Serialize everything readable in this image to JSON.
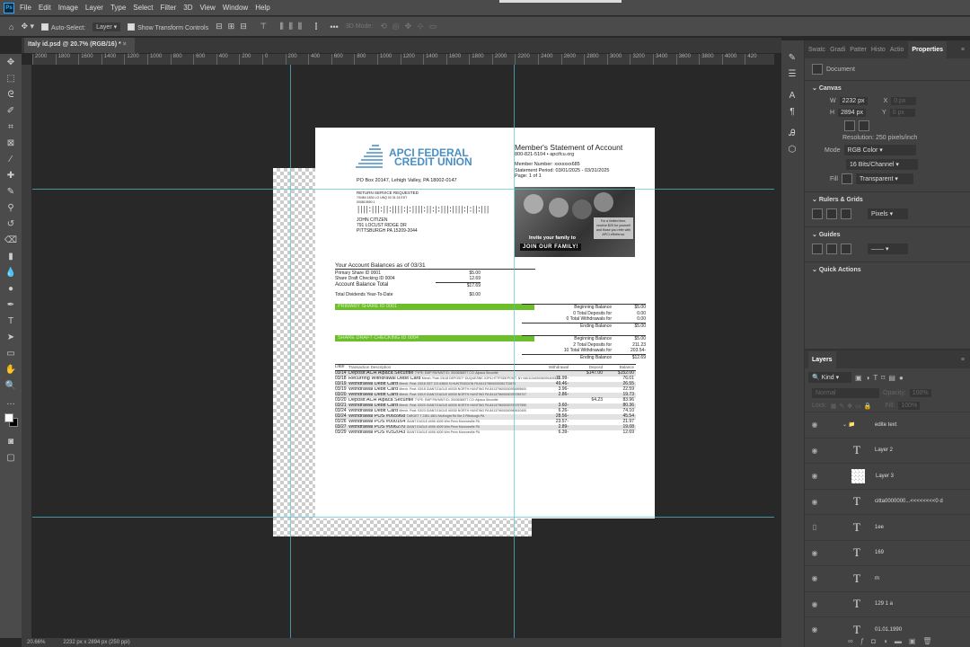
{
  "app": {
    "logo": "Ps",
    "menu": [
      "File",
      "Edit",
      "Image",
      "Layer",
      "Type",
      "Select",
      "Filter",
      "3D",
      "View",
      "Window",
      "Help"
    ]
  },
  "options": {
    "auto_select_label": "Auto-Select:",
    "auto_select_value": "Layer",
    "show_transform_label": "Show Transform Controls",
    "more": "•••",
    "mode_3d": "3D Mode:"
  },
  "document_tab": {
    "title": "Italy id.psd @ 20.7% (RGB/16) *",
    "close": "×"
  },
  "ruler": [
    "2000",
    "1800",
    "1600",
    "1400",
    "1200",
    "1000",
    "800",
    "600",
    "400",
    "200",
    "0",
    "200",
    "400",
    "600",
    "800",
    "1000",
    "1200",
    "1400",
    "1600",
    "1800",
    "2000",
    "2200",
    "2400",
    "2600",
    "2800",
    "3000",
    "3200",
    "3400",
    "3600",
    "3800",
    "4000",
    "420"
  ],
  "status": {
    "zoom": "20.66%",
    "size": "2232 px x 2894 px (250 ppi)"
  },
  "statement": {
    "org_line1": "APCI FEDERAL",
    "org_line2": "CREDIT UNION",
    "po_box": "PO Box 20147, Lehigh Valley, PA 18002-0147",
    "return_service": "RETURN SERVICE REQUESTED",
    "codes": "7/0484   1831      LO      UNQ              03 31 24 EST",
    "codes2": "000810590  1",
    "barcode": "||||:|||:||:||||:|:||||:||:|:|||:||||:|:||:|||",
    "name": "JOHN CITIZEN",
    "addr1": "791 LOCUST RIDGE DR",
    "addr2": "PITTSBURGH PA 15209-2044",
    "title": "Member's Statement of Account",
    "contact": "800-821-5104 • apcifcu.org",
    "member_number": "Member Number: xxxxxxx685",
    "period": "Statement Period: 03/01/2025 - 03/31/2025",
    "page": "Page: 1 of 1",
    "promo_invite": "Invite your family to",
    "promo_join": "JOIN OUR FAMILY!",
    "promo_side": "For a limited time, receive $25 for yourself and those you refer with APCI eReferral.",
    "balances_title": "Your Account Balances as of 03/31",
    "balances": [
      {
        "label": "Primary Share ID 0001",
        "value": "$5.00"
      },
      {
        "label": "Share Draft Checking ID 0004",
        "value": "12.69"
      }
    ],
    "total_label": "Account Balance Total",
    "total_value": "$17.69",
    "dividends_label": "Total Dividends Year-To-Date",
    "dividends_value": "$0.00",
    "sections": [
      {
        "name": "PRIMARY SHARE ID 0001",
        "rows": [
          [
            "Beginning Balance",
            "$5.00"
          ],
          [
            "0 Total Deposits for",
            "0.00"
          ],
          [
            "0 Total Withdrawals for",
            "0.00"
          ],
          [
            "Ending Balance",
            "$5.00"
          ]
        ]
      },
      {
        "name": "SHARE DRAFT CHECKING ID 0004",
        "rows": [
          [
            "Beginning Balance",
            "$5.00"
          ],
          [
            "2 Total Deposits for",
            "211.23"
          ],
          [
            "10 Total Withdrawals for",
            "203.54-"
          ],
          [
            "Ending Balance",
            "$12.69"
          ]
        ]
      }
    ],
    "tx_headers": {
      "date": "Date",
      "desc": "Transaction Description",
      "withdrawal": "Withdrawal",
      "deposit": "Deposit",
      "balance": "Balance"
    },
    "transactions": [
      {
        "date": "03/14",
        "title": "Deposit ACH Alpaca Securitie",
        "detail": "TYPE: EMP PAYMNT ID: 3003636877 CO: Alpaca Securitie",
        "withdrawal": "",
        "deposit": "$147.00",
        "balance": "$152.00",
        "shade": true
      },
      {
        "date": "03/18",
        "title": "Recurring Withdrawal Debit Card",
        "detail": "Merch. Post: 03/18 DEPOSIT* DUQUESNE JOP4 HTTPSDEPOSIT, NY 640113400006391409348",
        "withdrawal": "75.99-",
        "deposit": "",
        "balance": "76.01",
        "shade": false
      },
      {
        "date": "03/19",
        "title": "Withdrawal Debit Card",
        "detail": "Merch. Post: 03/18 GET GO #3600 N HUNTINGDON PA 841379600000061702670",
        "withdrawal": "49.46-",
        "deposit": "",
        "balance": "26.55",
        "shade": true
      },
      {
        "date": "03/19",
        "title": "Withdrawal Debit Card",
        "detail": "Merch. Post: 03/18 GIANT-EAGLE #0030 NORTH HUNTING PA 841379600000934895600",
        "withdrawal": "3.96-",
        "deposit": "",
        "balance": "22.59",
        "shade": false
      },
      {
        "date": "03/20",
        "title": "Withdrawal Debit Card",
        "detail": "Merch. Post: 03/19 GIANT-EAGLE #0030 NORTH HUNTING PA 841379600000789789707",
        "withdrawal": "2.86-",
        "deposit": "",
        "balance": "19.73",
        "shade": true
      },
      {
        "date": "03/20",
        "title": "Deposit ACH Alpaca Securitie",
        "detail": "TYPE: EMP PAYMNT ID: 3003636877 CO: Alpaca Securitie",
        "withdrawal": "",
        "deposit": "64.23",
        "balance": "83.96",
        "shade": false
      },
      {
        "date": "03/21",
        "title": "Withdrawal Debit Card",
        "detail": "Merch. Post: 03/20 GIANT-EAGLE #0030 NORTH HUNTING PA 841379600000753797550",
        "withdrawal": "3.60-",
        "deposit": "",
        "balance": "80.36",
        "shade": true
      },
      {
        "date": "03/24",
        "title": "Withdrawal Debit Card",
        "detail": "Merch. Post: 03/23 GIANT-EAGLE #0030 NORTH HUNTING PA 841379600000949610400",
        "withdrawal": "6.26-",
        "deposit": "",
        "balance": "74.10",
        "shade": false
      },
      {
        "date": "03/24",
        "title": "Withdrawal POS #065968",
        "detail": "TARGET T 2281 4801 McKnight Rd Ste 3 Pittsburgh PA",
        "withdrawal": "28.56-",
        "deposit": "",
        "balance": "45.54",
        "shade": true
      },
      {
        "date": "03/26",
        "title": "Withdrawal POS #000164",
        "detail": "GIANT EAGLE #006 4009 Wm Penn Monroeville PA",
        "withdrawal": "23.57-",
        "deposit": "",
        "balance": "21.97",
        "shade": false
      },
      {
        "date": "03/27",
        "title": "Withdrawal POS #006270",
        "detail": "GIANT EAGLE #006 4009 Wm Penn Monroeville PA",
        "withdrawal": "2.89-",
        "deposit": "",
        "balance": "19.08",
        "shade": true
      },
      {
        "date": "03/29",
        "title": "Withdrawal POS #252043",
        "detail": "GIANT EAGLE #006 4009 Wm Penn Monroeville PA",
        "withdrawal": "6.39-",
        "deposit": "",
        "balance": "12.69",
        "shade": false
      }
    ]
  },
  "properties": {
    "tabs": [
      "Swatc",
      "Gradi",
      "Patter",
      "Histo",
      "Actio",
      "Properties"
    ],
    "doc_label": "Document",
    "canvas_title": "Canvas",
    "w_label": "W",
    "w_value": "2232 px",
    "h_label": "H",
    "h_value": "2894 px",
    "x_label": "X",
    "x_value": "0 px",
    "y_label": "Y",
    "y_value": "0 px",
    "resolution": "Resolution: 250 pixels/inch",
    "mode_label": "Mode",
    "mode_value": "RGB Color",
    "depth_value": "16 Bits/Channel",
    "fill_label": "Fill",
    "fill_value": "Transparent",
    "rulers_title": "Rulers & Grids",
    "units_value": "Pixels",
    "guides_title": "Guides",
    "quick_actions_title": "Quick Actions"
  },
  "layers": {
    "tab": "Layers",
    "kind": "Kind",
    "blend": "Normal",
    "opacity_label": "Opacity:",
    "opacity_value": "100%",
    "lock_label": "Lock:",
    "fill_label": "Fill:",
    "fill_value": "100%",
    "items": [
      {
        "name": "edite text",
        "type": "group",
        "visible": true
      },
      {
        "name": "Layer 2",
        "type": "text",
        "visible": true
      },
      {
        "name": "Layer 3",
        "type": "image",
        "visible": true
      },
      {
        "name": "citta0000000...<<<<<<<<0 d",
        "type": "text",
        "visible": true
      },
      {
        "name": "1ee",
        "type": "text",
        "visible": false
      },
      {
        "name": "169",
        "type": "text",
        "visible": true
      },
      {
        "name": "m",
        "type": "text",
        "visible": true
      },
      {
        "name": "129 1 a",
        "type": "text",
        "visible": true
      },
      {
        "name": "01.01.1990",
        "type": "text",
        "visible": true
      }
    ]
  },
  "colors": {
    "accent_green": "#6cbf2a",
    "logo_blue": "#4a8fc4",
    "guide": "#4fc3d6",
    "panel": "#424242",
    "canvas": "#282828"
  }
}
